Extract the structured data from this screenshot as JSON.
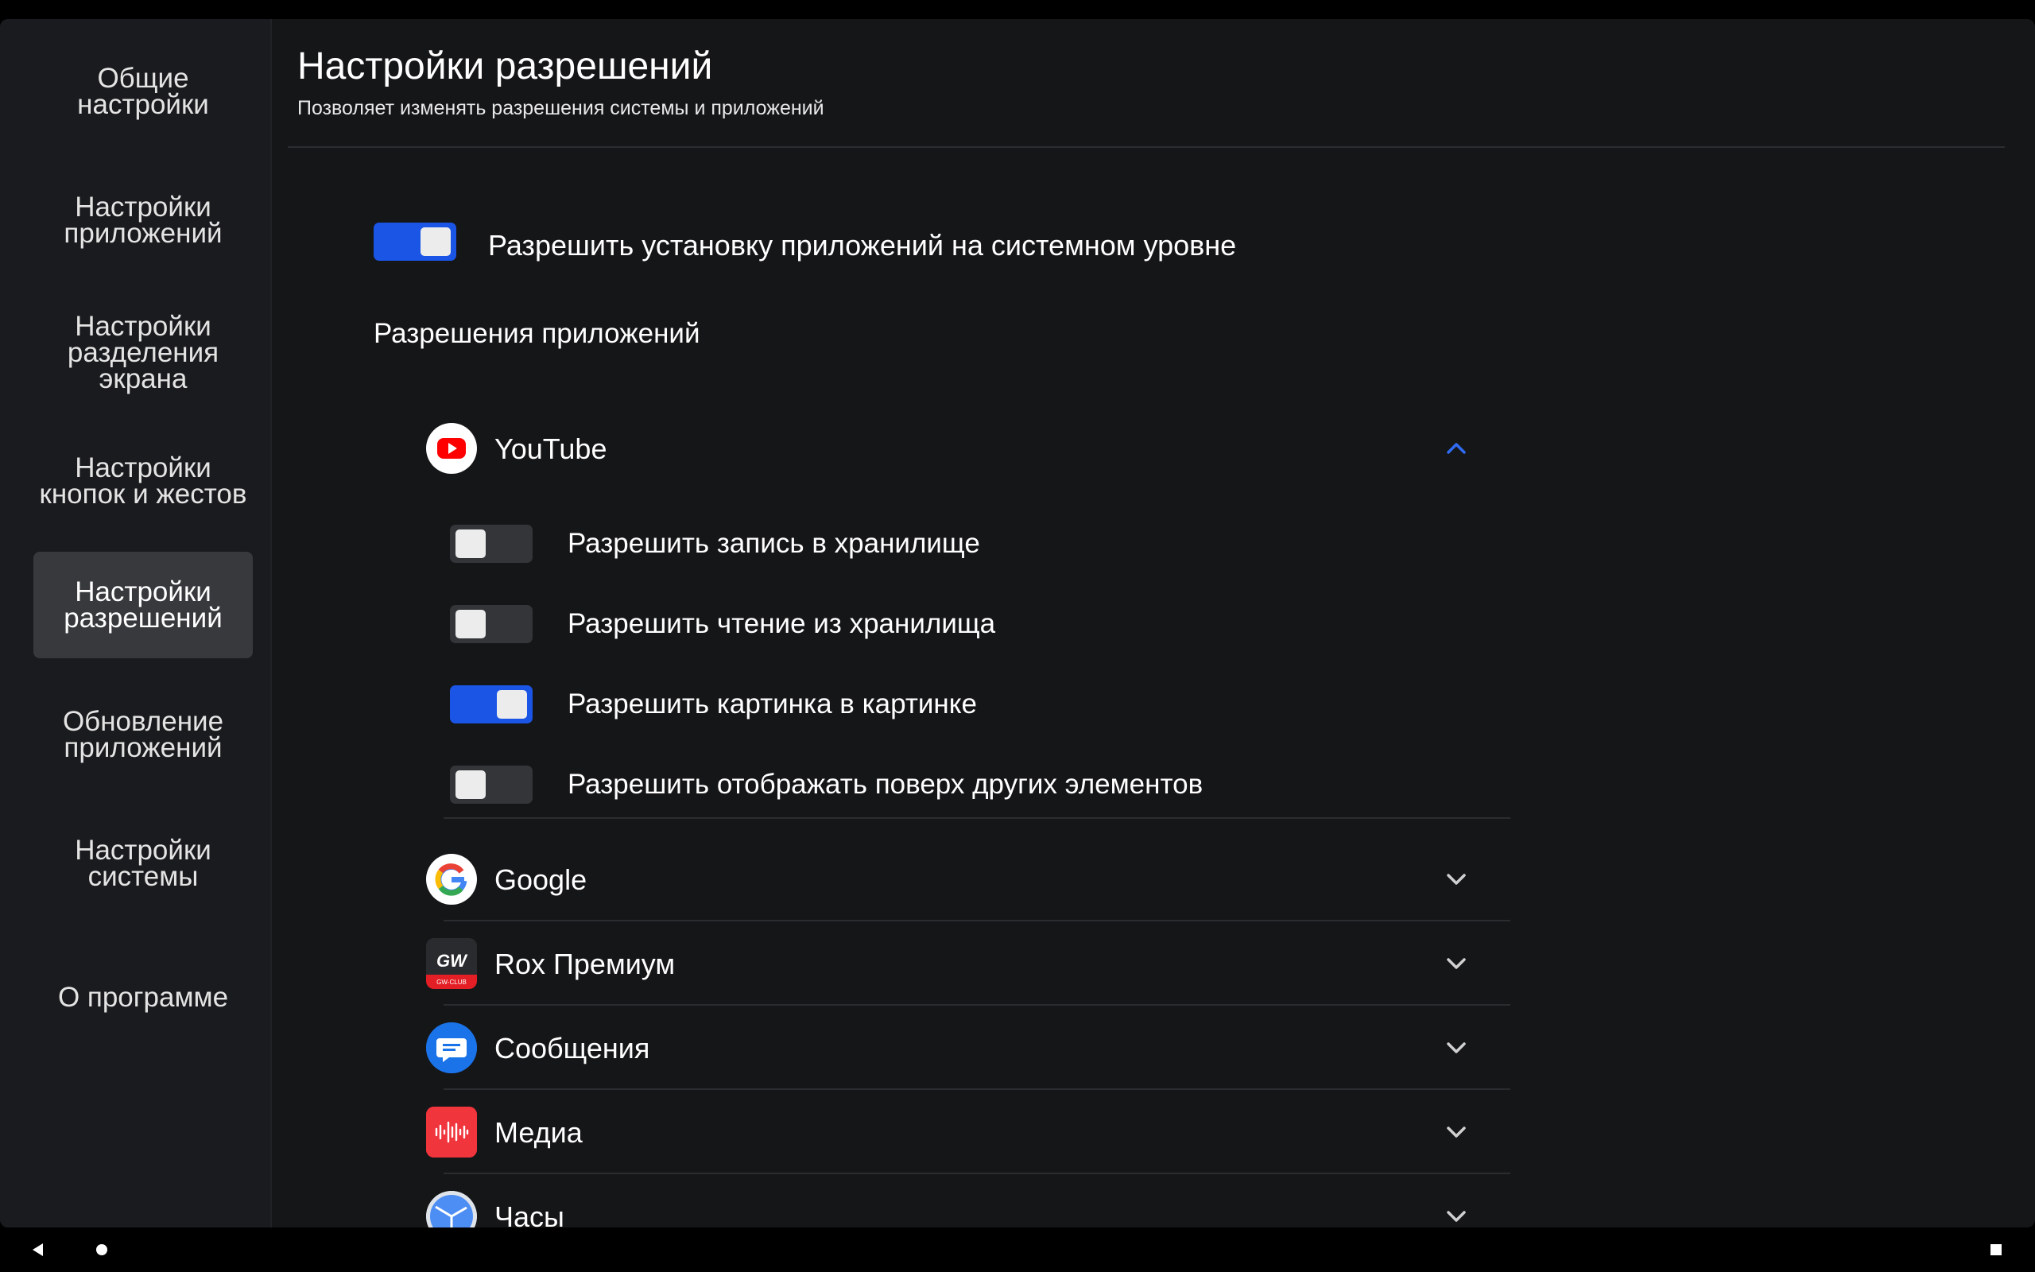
{
  "sidebar": {
    "items": [
      {
        "label": "Общие настройки",
        "active": false
      },
      {
        "label": "Настройки приложений",
        "active": false
      },
      {
        "label": "Настройки разделения экрана",
        "active": false
      },
      {
        "label": "Настройки кнопок и жестов",
        "active": false
      },
      {
        "label": "Настройки разрешений",
        "active": true
      },
      {
        "label": "Обновление приложений",
        "active": false
      },
      {
        "label": "Настройки системы",
        "active": false
      },
      {
        "label": "О программе",
        "active": false
      }
    ]
  },
  "header": {
    "title": "Настройки разрешений",
    "subtitle": "Позволяет изменять разрешения системы и приложений"
  },
  "system_install": {
    "label": "Разрешить установку приложений на системном уровне",
    "enabled": true
  },
  "app_permissions": {
    "section_label": "Разрешения приложений",
    "apps": [
      {
        "name": "YouTube",
        "icon": "youtube-icon",
        "expanded": true,
        "permissions": [
          {
            "label": "Разрешить запись в хранилище",
            "enabled": false
          },
          {
            "label": "Разрешить чтение из хранилища",
            "enabled": false
          },
          {
            "label": "Разрешить картинка в картинке",
            "enabled": true
          },
          {
            "label": "Разрешить отображать поверх других элементов",
            "enabled": false
          }
        ]
      },
      {
        "name": "Google",
        "icon": "google-icon",
        "expanded": false
      },
      {
        "name": "Rox Премиум",
        "icon": "gw-club-icon",
        "icon_text": "GW",
        "icon_subtext": "GW-CLUB",
        "expanded": false
      },
      {
        "name": "Сообщения",
        "icon": "messages-icon",
        "expanded": false
      },
      {
        "name": "Медиа",
        "icon": "media-icon",
        "expanded": false
      },
      {
        "name": "Часы",
        "icon": "clock-icon",
        "expanded": false
      }
    ]
  },
  "colors": {
    "accent": "#1a55e6",
    "background": "#151618",
    "sidebar_background": "#1a1b1e",
    "active_nav_background": "#37393d"
  },
  "system_nav": {
    "icons": [
      "back-icon",
      "home-icon",
      "recents-icon"
    ]
  }
}
